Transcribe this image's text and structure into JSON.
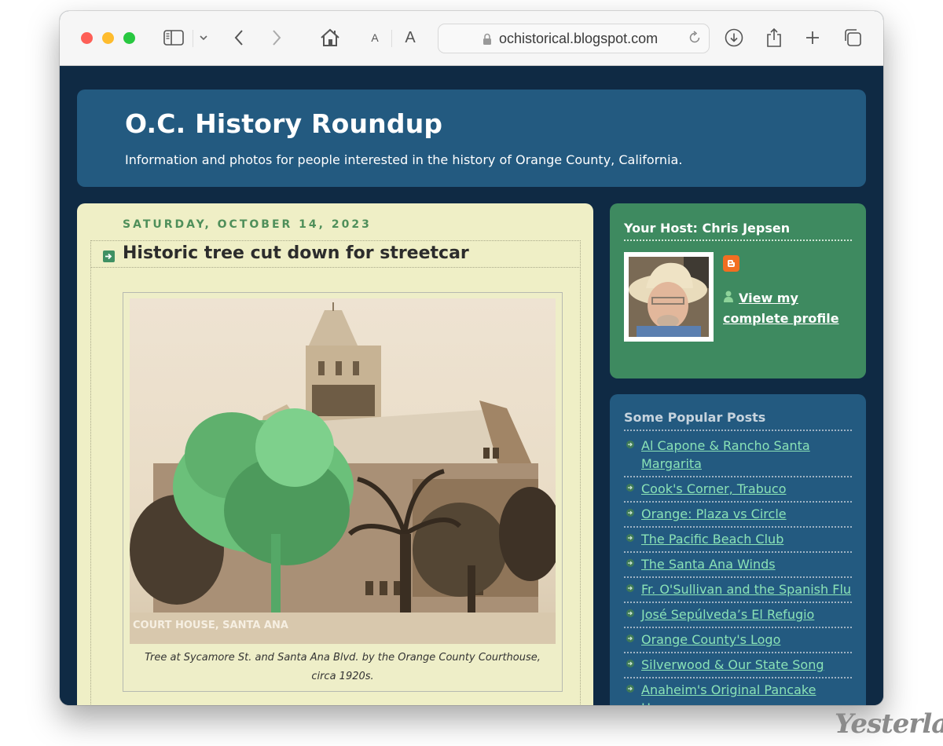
{
  "browser": {
    "url": "ochistorical.blogspot.com",
    "toolbar_icons": [
      "sidebar-icon",
      "chevron-down-icon",
      "back-icon",
      "forward-icon",
      "home-icon",
      "text-smaller-icon",
      "text-larger-icon",
      "lock-icon",
      "reload-icon",
      "download-icon",
      "share-icon",
      "new-tab-icon",
      "tabs-overview-icon"
    ],
    "text_small_label": "A",
    "text_large_label": "A"
  },
  "header": {
    "title": "O.C. History Roundup",
    "description": "Information and photos for people interested in the history of Orange County, California."
  },
  "post": {
    "date": "SATURDAY, OCTOBER 14, 2023",
    "title": "Historic tree cut down for streetcar",
    "photo_label": "COURT HOUSE, SANTA ANA",
    "caption": "Tree at Sycamore St. and Santa Ana Blvd. by the Orange County Courthouse, circa 1920s."
  },
  "sidebar": {
    "host": {
      "title": "Your Host: Chris Jepsen",
      "profile_link": "View my complete profile"
    },
    "popular": {
      "title": "Some Popular Posts",
      "items": [
        "Al Capone & Rancho Santa Margarita",
        "Cook's Corner, Trabuco",
        "Orange: Plaza vs Circle",
        "The Pacific Beach Club",
        "The Santa Ana Winds",
        "Fr. O'Sullivan and the Spanish Flu",
        "José Sepúlveda’s El Refugio",
        "Orange County's Logo",
        "Silverwood & Our State Song",
        "Anaheim's Original Pancake House"
      ]
    }
  },
  "watermark": "Yesterland",
  "colors": {
    "page_bg": "#0f2a44",
    "header_bg": "#235a80",
    "post_bg": "#efefc6",
    "host_bg": "#3e8a60",
    "link": "#8ae2b6",
    "date": "#4f8f5a"
  }
}
